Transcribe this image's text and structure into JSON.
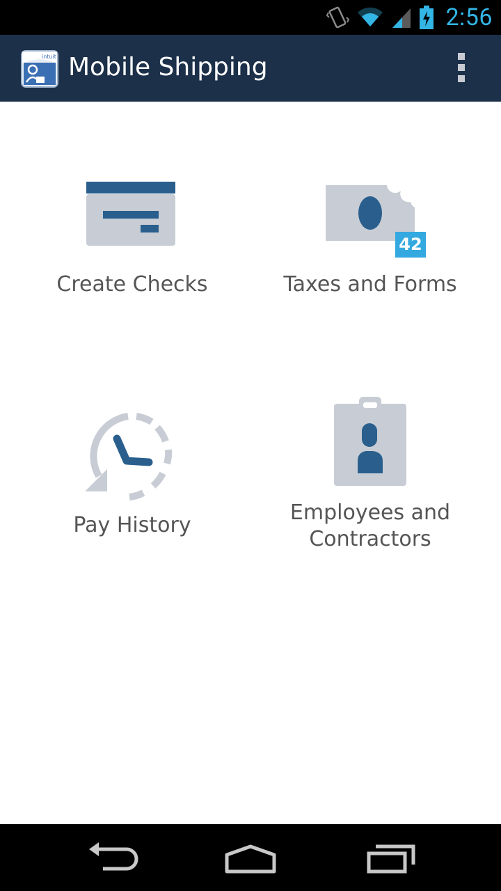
{
  "status_bar": {
    "time": "2:56",
    "icons": [
      "vibrate-icon",
      "wifi-icon",
      "signal-icon",
      "battery-charging-icon"
    ]
  },
  "action_bar": {
    "title": "Mobile Shipping",
    "logo_text": "intuit",
    "overflow_icon": "overflow-menu-icon"
  },
  "tiles": {
    "create_checks": {
      "label": "Create Checks",
      "icon": "check-icon"
    },
    "taxes_forms": {
      "label": "Taxes and Forms",
      "icon": "tax-form-icon",
      "badge": "42"
    },
    "pay_history": {
      "label": "Pay History",
      "icon": "clock-history-icon"
    },
    "employees": {
      "label_line1": "Employees and",
      "label_line2": "Contractors",
      "icon": "id-badge-icon"
    }
  },
  "nav_bar": {
    "back": "back-icon",
    "home": "home-icon",
    "recents": "recent-apps-icon"
  },
  "colors": {
    "status_accent": "#33b5e5",
    "action_bar": "#1c3049",
    "icon_dark": "#2a5f8d",
    "icon_light": "#c8cdd5",
    "badge": "#33a9e0"
  }
}
